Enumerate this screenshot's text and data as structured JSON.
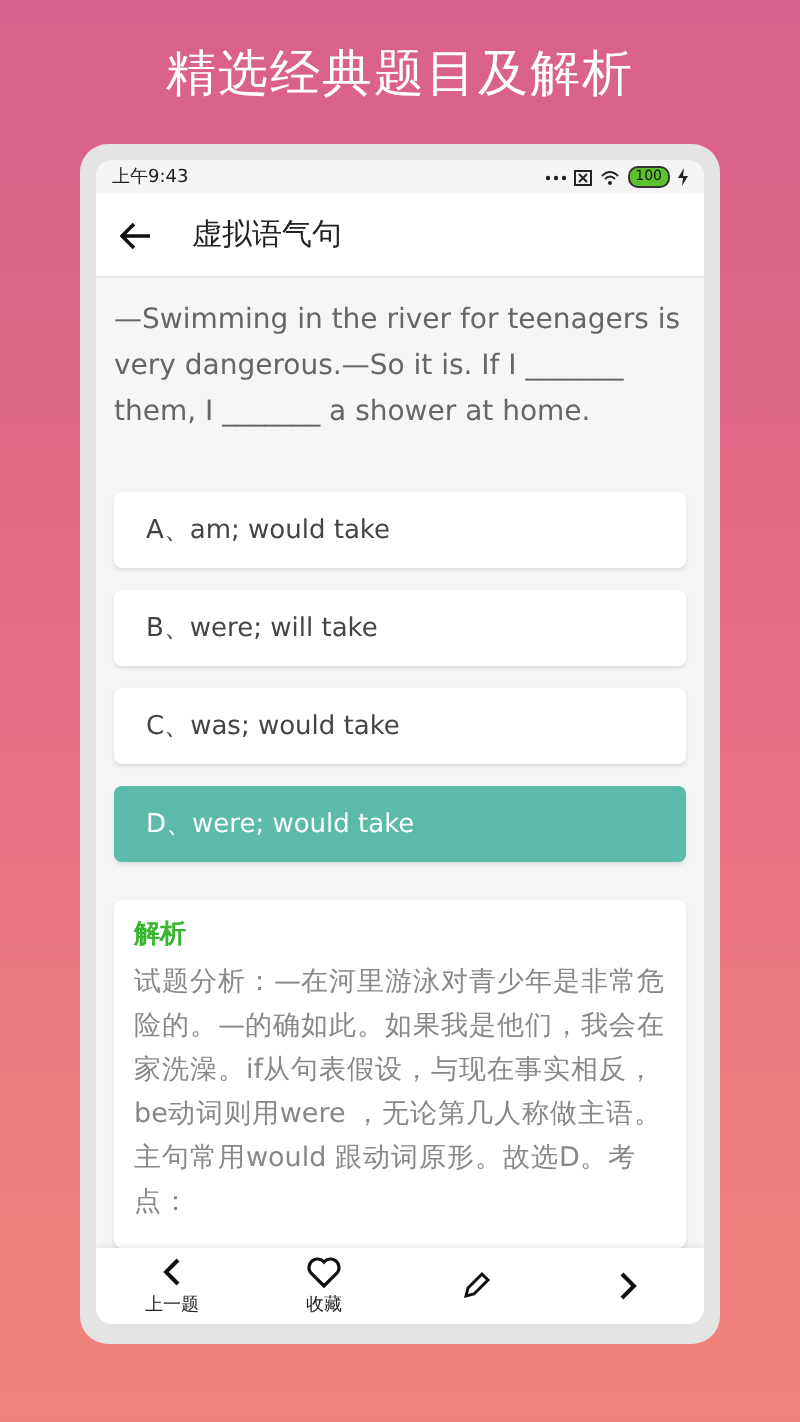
{
  "headline": "精选经典题目及解析",
  "status_bar": {
    "time": "上午9:43",
    "battery": "100"
  },
  "header": {
    "title": "虚拟语气句"
  },
  "question": "—Swimming in the river for teenagers is very dangerous.—So it is. If I _______ them, I _______ a shower at home.",
  "options": [
    {
      "label": "A、am; would take",
      "selected": false
    },
    {
      "label": "B、were; will take",
      "selected": false
    },
    {
      "label": "C、was; would take",
      "selected": false
    },
    {
      "label": "D、were; would take",
      "selected": true
    }
  ],
  "analysis": {
    "heading": "解析",
    "text": "试题分析：—在河里游泳对青少年是非常危险的。—的确如此。如果我是他们，我会在家洗澡。if从句表假设，与现在事实相反，be动词则用were ，无论第几人称做主语。主句常用would 跟动词原形。故选D。考点："
  },
  "bottom_nav": [
    {
      "kind": "prev",
      "label": "上一题"
    },
    {
      "kind": "favorite",
      "label": "收藏"
    },
    {
      "kind": "edit"
    },
    {
      "kind": "next"
    }
  ]
}
